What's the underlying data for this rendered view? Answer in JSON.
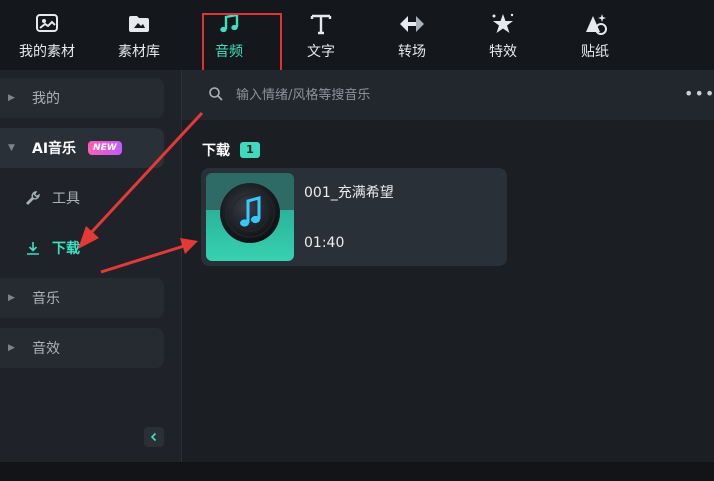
{
  "toolbar": {
    "items": [
      {
        "label": "我的素材",
        "icon": "media-library-icon"
      },
      {
        "label": "素材库",
        "icon": "stock-library-icon"
      },
      {
        "label": "音频",
        "icon": "music-note-icon"
      },
      {
        "label": "文字",
        "icon": "text-icon"
      },
      {
        "label": "转场",
        "icon": "transition-icon"
      },
      {
        "label": "特效",
        "icon": "effects-icon"
      },
      {
        "label": "贴纸",
        "icon": "sticker-icon"
      }
    ],
    "active_index": 2,
    "more_label": "›"
  },
  "sidebar": {
    "categories": [
      {
        "label": "我的",
        "expanded": false
      },
      {
        "label": "AI音乐",
        "expanded": true,
        "badge": "NEW"
      },
      {
        "label": "音乐",
        "expanded": false
      },
      {
        "label": "音效",
        "expanded": false
      }
    ],
    "sub_items": [
      {
        "label": "工具",
        "icon": "wrench-icon"
      },
      {
        "label": "下载",
        "icon": "download-icon",
        "selected": true
      }
    ],
    "collapse_icon": "chevron-left-icon"
  },
  "search": {
    "placeholder": "输入情绪/风格等搜音乐",
    "value": "",
    "more_icon": "more-dots-icon"
  },
  "section": {
    "title": "下载",
    "count": "1"
  },
  "tracks": [
    {
      "title": "001_充满希望",
      "duration": "01:40",
      "thumbnail_icon": "vinyl-music-icon"
    }
  ],
  "colors": {
    "accent": "#3fe0c2",
    "highlight_box": "#e0322e",
    "annotation_arrow": "#e53935",
    "new_badge": "#d65cff"
  }
}
